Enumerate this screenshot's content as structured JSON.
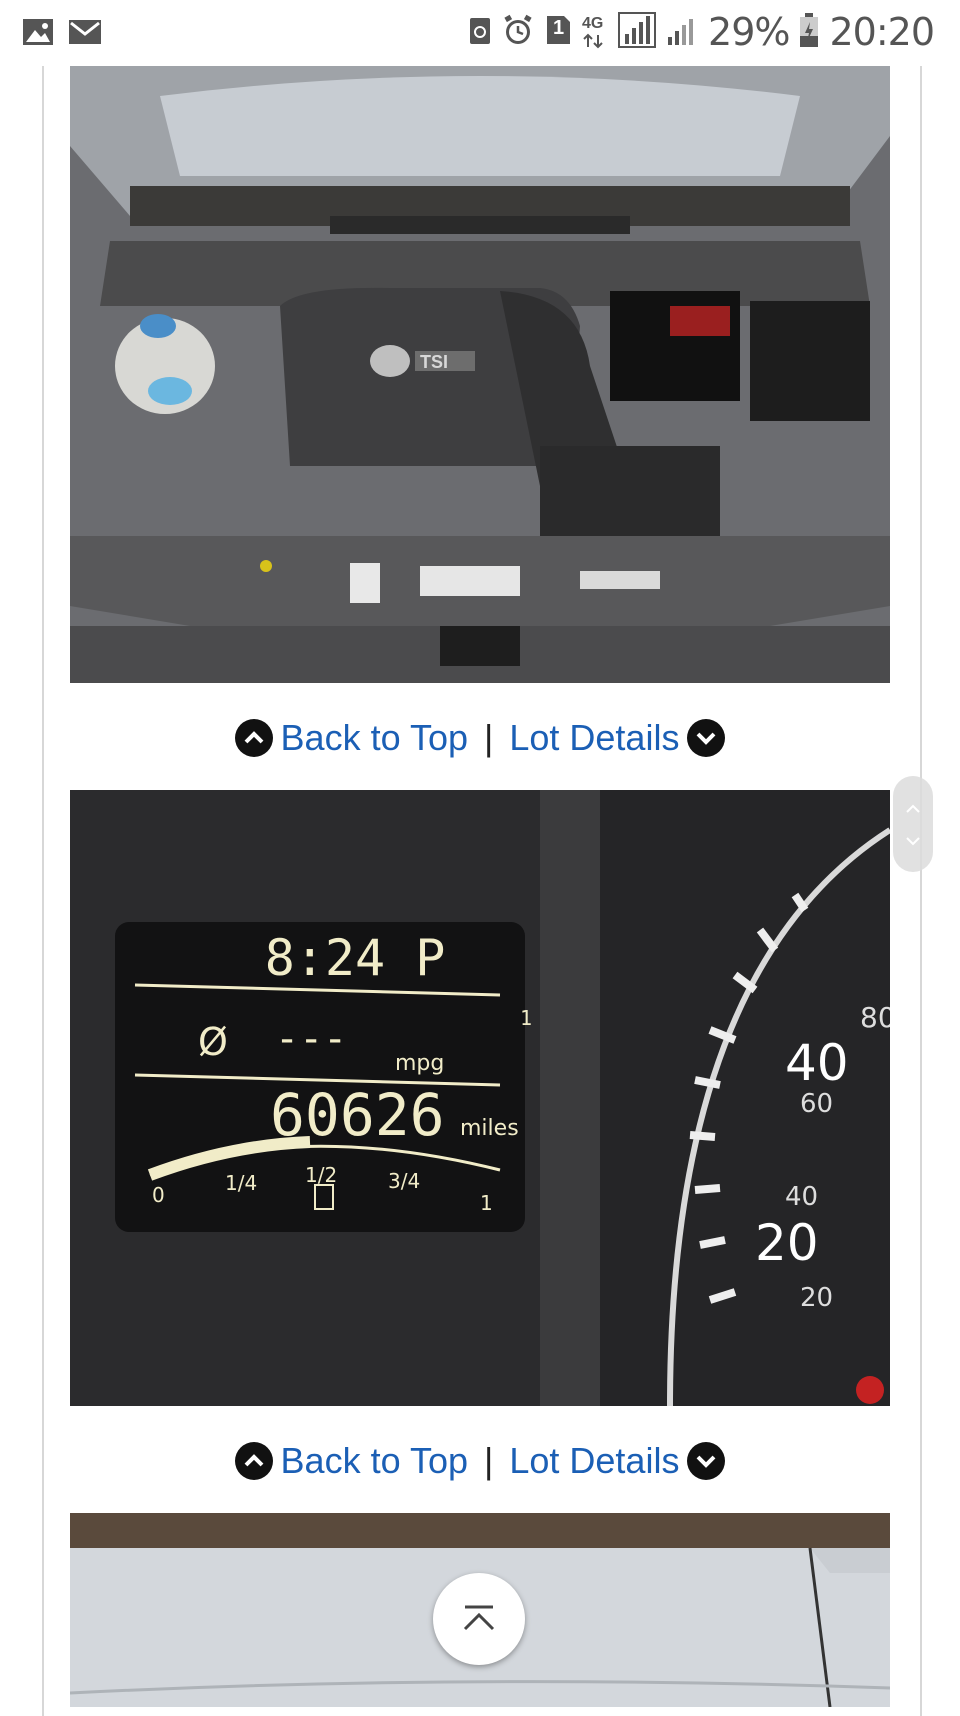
{
  "status_bar": {
    "battery_percent": "29%",
    "time": "20:20",
    "network": "4G",
    "sim_badge": "1",
    "icons": [
      "image-icon",
      "gmail-icon",
      "recycle-icon",
      "alarm-icon",
      "sim-icon",
      "network-4g-icon",
      "signal-icon",
      "signal-icon",
      "battery-icon"
    ]
  },
  "nav": {
    "back_to_top": "Back to Top",
    "separator": "|",
    "lot_details": "Lot Details"
  },
  "dashboard": {
    "clock": "8:24 P",
    "avg_symbol": "Ø",
    "mpg_value": "---",
    "mpg_unit": "mpg",
    "odometer": "60626",
    "odometer_unit": "miles",
    "fuel_labels": [
      "0",
      "1/4",
      "1/2",
      "3/4",
      "1"
    ],
    "fuel_level": 0.45,
    "speed_labels": [
      "80",
      "40",
      "60",
      "40",
      "20",
      "20"
    ],
    "trip_number": "1"
  },
  "engine_photo": {
    "badge": "TSI"
  }
}
